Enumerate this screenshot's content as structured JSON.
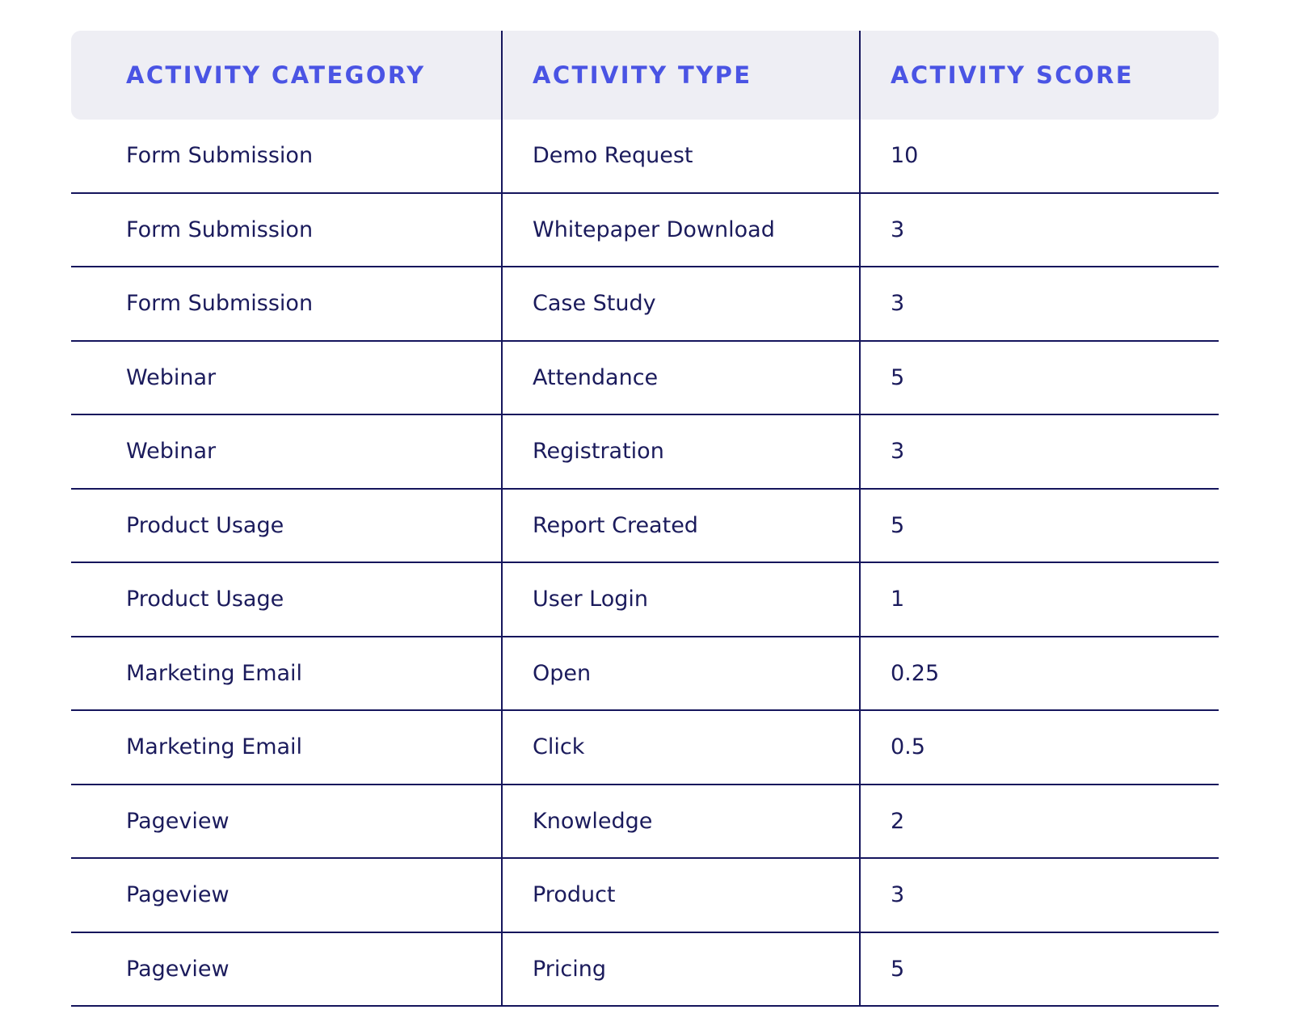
{
  "table": {
    "columns": [
      {
        "key": "category",
        "label": "Activity Category"
      },
      {
        "key": "type",
        "label": "Activity Type"
      },
      {
        "key": "score",
        "label": "Activity Score"
      }
    ],
    "rows": [
      {
        "category": "Form Submission",
        "type": "Demo Request",
        "score": "10"
      },
      {
        "category": "Form Submission",
        "type": "Whitepaper Download",
        "score": "3"
      },
      {
        "category": "Form Submission",
        "type": "Case Study",
        "score": "3"
      },
      {
        "category": "Webinar",
        "type": "Attendance",
        "score": "5"
      },
      {
        "category": "Webinar",
        "type": "Registration",
        "score": "3"
      },
      {
        "category": "Product Usage",
        "type": "Report Created",
        "score": "5"
      },
      {
        "category": "Product Usage",
        "type": "User Login",
        "score": "1"
      },
      {
        "category": "Marketing Email",
        "type": "Open",
        "score": "0.25"
      },
      {
        "category": "Marketing Email",
        "type": "Click",
        "score": "0.5"
      },
      {
        "category": "Pageview",
        "type": "Knowledge",
        "score": "2"
      },
      {
        "category": "Pageview",
        "type": "Product",
        "score": "3"
      },
      {
        "category": "Pageview",
        "type": "Pricing",
        "score": "5"
      }
    ]
  },
  "colors": {
    "header_background": "#eeeef4",
    "header_text": "#4a54e4",
    "body_text": "#1b1b5c",
    "border": "#15155c",
    "page_background": "#ffffff"
  },
  "chart_data": {
    "type": "table",
    "title": "",
    "columns": [
      "Activity Category",
      "Activity Type",
      "Activity Score"
    ],
    "rows": [
      [
        "Form Submission",
        "Demo Request",
        10
      ],
      [
        "Form Submission",
        "Whitepaper Download",
        3
      ],
      [
        "Form Submission",
        "Case Study",
        3
      ],
      [
        "Webinar",
        "Attendance",
        5
      ],
      [
        "Webinar",
        "Registration",
        3
      ],
      [
        "Product Usage",
        "Report Created",
        5
      ],
      [
        "Product Usage",
        "User Login",
        1
      ],
      [
        "Marketing Email",
        "Open",
        0.25
      ],
      [
        "Marketing Email",
        "Click",
        0.5
      ],
      [
        "Pageview",
        "Knowledge",
        2
      ],
      [
        "Pageview",
        "Product",
        3
      ],
      [
        "Pageview",
        "Pricing",
        5
      ]
    ]
  }
}
